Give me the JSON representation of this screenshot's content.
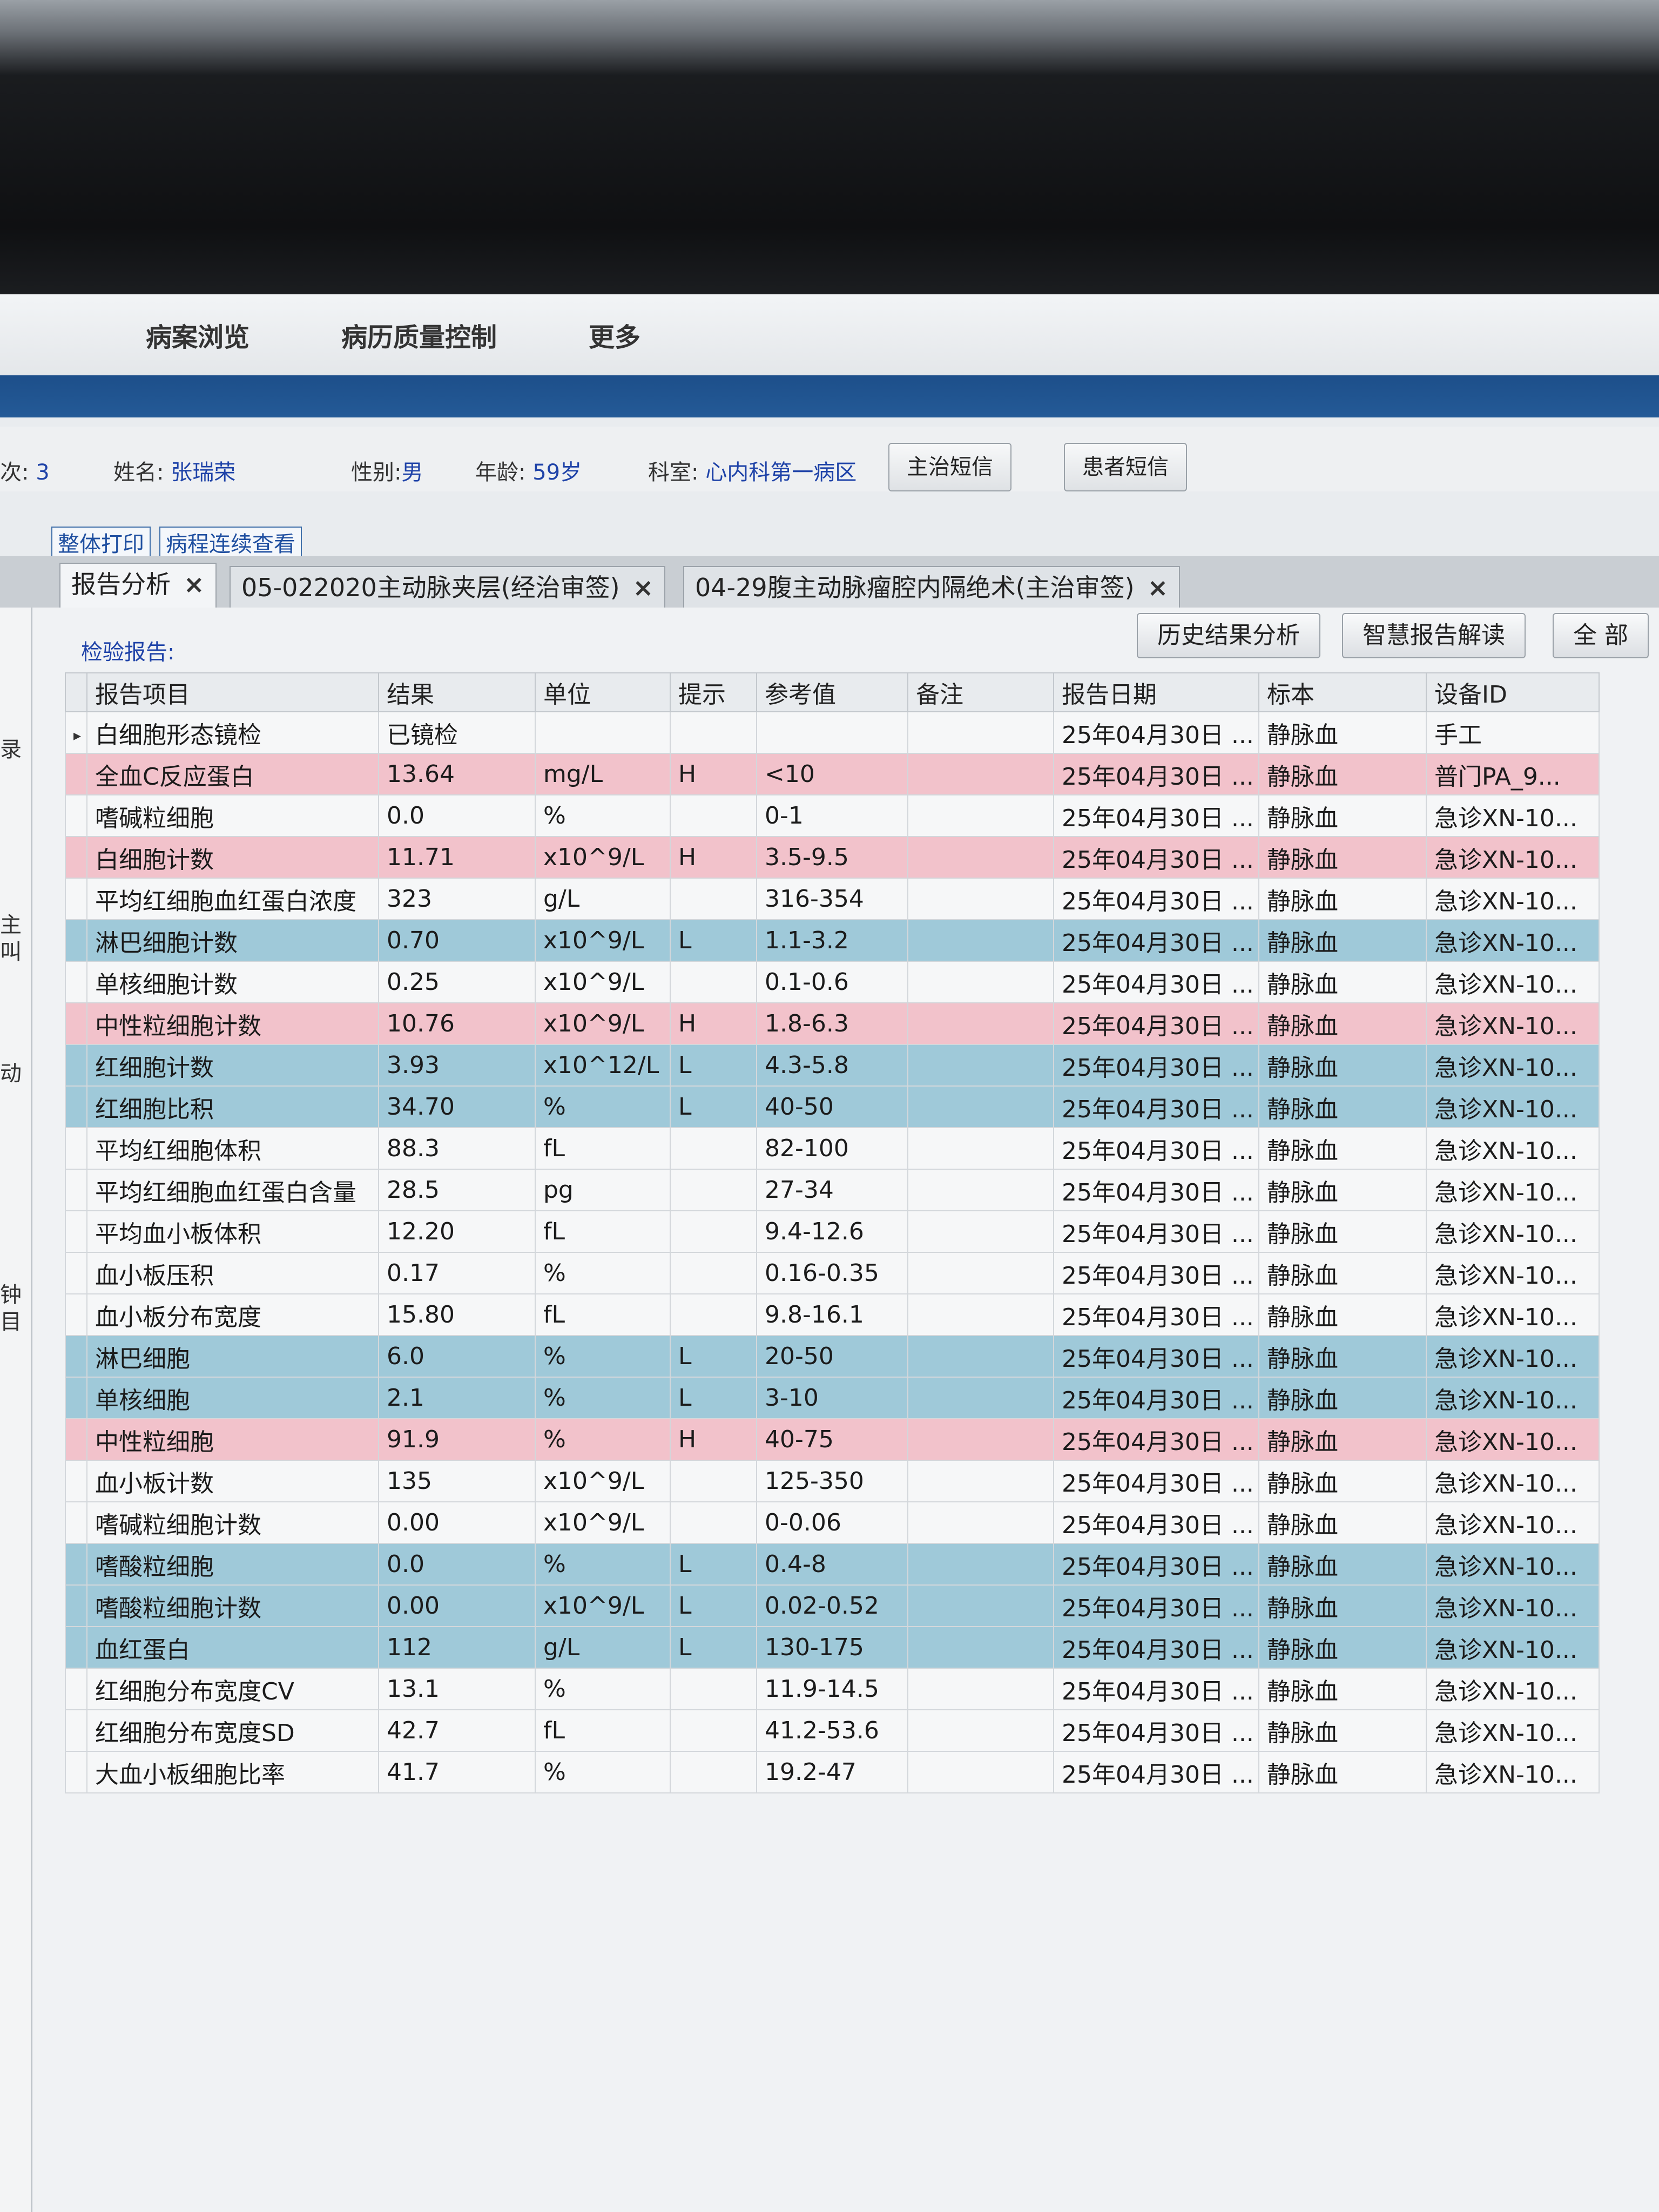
{
  "menu": [
    "病案浏览",
    "病历质量控制",
    "更多"
  ],
  "patient": {
    "visit_label": "次:",
    "visit_value": "3",
    "name_label": "姓名:",
    "name_value": "张瑞荣",
    "sex_label": "性别:",
    "sex_value": "男",
    "age_label": "年龄:",
    "age_value": "59岁",
    "dept_label": "科室:",
    "dept_value": "心内科第一病区",
    "sms_doctor": "主治短信",
    "sms_patient": "患者短信"
  },
  "links": {
    "print_all": "整体打印",
    "course_view": "病程连续查看"
  },
  "tabs": [
    {
      "label": "报告分析",
      "close": "×"
    },
    {
      "label": "05-022020主动脉夹层(经治审签)",
      "close": "×"
    },
    {
      "label": "04-29腹主动脉瘤腔内隔绝术(主治审签)",
      "close": "×"
    }
  ],
  "actions": {
    "history": "历史结果分析",
    "smart": "智慧报告解读",
    "all": "全 部"
  },
  "section_label": "检验报告:",
  "left_strip_chars": [
    "录",
    "主",
    "叫",
    "动",
    "钟",
    "目"
  ],
  "columns": [
    "报告项目",
    "结果",
    "单位",
    "提示",
    "参考值",
    "备注",
    "报告日期",
    "标本",
    "设备ID"
  ],
  "rows": [
    {
      "flag": "",
      "item": "白细胞形态镜检",
      "result": "已镜检",
      "unit": "",
      "hint": "",
      "ref": "",
      "note": "",
      "date": "25年04月30日 ...",
      "specimen": "静脉血",
      "device": "手工",
      "arrow": "▸"
    },
    {
      "flag": "high",
      "item": "全血C反应蛋白",
      "result": "13.64",
      "unit": "mg/L",
      "hint": "H",
      "ref": "<10",
      "note": "",
      "date": "25年04月30日 ...",
      "specimen": "静脉血",
      "device": "普门PA_9...",
      "arrow": ""
    },
    {
      "flag": "",
      "item": "嗜碱粒细胞",
      "result": "0.0",
      "unit": "%",
      "hint": "",
      "ref": "0-1",
      "note": "",
      "date": "25年04月30日 ...",
      "specimen": "静脉血",
      "device": "急诊XN-10...",
      "arrow": ""
    },
    {
      "flag": "high",
      "item": "白细胞计数",
      "result": "11.71",
      "unit": "x10^9/L",
      "hint": "H",
      "ref": "3.5-9.5",
      "note": "",
      "date": "25年04月30日 ...",
      "specimen": "静脉血",
      "device": "急诊XN-10...",
      "arrow": ""
    },
    {
      "flag": "",
      "item": "平均红细胞血红蛋白浓度",
      "result": "323",
      "unit": "g/L",
      "hint": "",
      "ref": "316-354",
      "note": "",
      "date": "25年04月30日 ...",
      "specimen": "静脉血",
      "device": "急诊XN-10...",
      "arrow": ""
    },
    {
      "flag": "low",
      "item": "淋巴细胞计数",
      "result": "0.70",
      "unit": "x10^9/L",
      "hint": "L",
      "ref": "1.1-3.2",
      "note": "",
      "date": "25年04月30日 ...",
      "specimen": "静脉血",
      "device": "急诊XN-10...",
      "arrow": ""
    },
    {
      "flag": "",
      "item": "单核细胞计数",
      "result": "0.25",
      "unit": "x10^9/L",
      "hint": "",
      "ref": "0.1-0.6",
      "note": "",
      "date": "25年04月30日 ...",
      "specimen": "静脉血",
      "device": "急诊XN-10...",
      "arrow": ""
    },
    {
      "flag": "high",
      "item": "中性粒细胞计数",
      "result": "10.76",
      "unit": "x10^9/L",
      "hint": "H",
      "ref": "1.8-6.3",
      "note": "",
      "date": "25年04月30日 ...",
      "specimen": "静脉血",
      "device": "急诊XN-10...",
      "arrow": ""
    },
    {
      "flag": "low",
      "item": "红细胞计数",
      "result": "3.93",
      "unit": "x10^12/L",
      "hint": "L",
      "ref": "4.3-5.8",
      "note": "",
      "date": "25年04月30日 ...",
      "specimen": "静脉血",
      "device": "急诊XN-10...",
      "arrow": ""
    },
    {
      "flag": "low",
      "item": "红细胞比积",
      "result": "34.70",
      "unit": "%",
      "hint": "L",
      "ref": "40-50",
      "note": "",
      "date": "25年04月30日 ...",
      "specimen": "静脉血",
      "device": "急诊XN-10...",
      "arrow": ""
    },
    {
      "flag": "",
      "item": "平均红细胞体积",
      "result": "88.3",
      "unit": "fL",
      "hint": "",
      "ref": "82-100",
      "note": "",
      "date": "25年04月30日 ...",
      "specimen": "静脉血",
      "device": "急诊XN-10...",
      "arrow": ""
    },
    {
      "flag": "",
      "item": "平均红细胞血红蛋白含量",
      "result": "28.5",
      "unit": "pg",
      "hint": "",
      "ref": "27-34",
      "note": "",
      "date": "25年04月30日 ...",
      "specimen": "静脉血",
      "device": "急诊XN-10...",
      "arrow": ""
    },
    {
      "flag": "",
      "item": "平均血小板体积",
      "result": "12.20",
      "unit": "fL",
      "hint": "",
      "ref": "9.4-12.6",
      "note": "",
      "date": "25年04月30日 ...",
      "specimen": "静脉血",
      "device": "急诊XN-10...",
      "arrow": ""
    },
    {
      "flag": "",
      "item": "血小板压积",
      "result": "0.17",
      "unit": "%",
      "hint": "",
      "ref": "0.16-0.35",
      "note": "",
      "date": "25年04月30日 ...",
      "specimen": "静脉血",
      "device": "急诊XN-10...",
      "arrow": ""
    },
    {
      "flag": "",
      "item": "血小板分布宽度",
      "result": "15.80",
      "unit": "fL",
      "hint": "",
      "ref": "9.8-16.1",
      "note": "",
      "date": "25年04月30日 ...",
      "specimen": "静脉血",
      "device": "急诊XN-10...",
      "arrow": ""
    },
    {
      "flag": "low",
      "item": "淋巴细胞",
      "result": "6.0",
      "unit": "%",
      "hint": "L",
      "ref": "20-50",
      "note": "",
      "date": "25年04月30日 ...",
      "specimen": "静脉血",
      "device": "急诊XN-10...",
      "arrow": ""
    },
    {
      "flag": "low",
      "item": "单核细胞",
      "result": "2.1",
      "unit": "%",
      "hint": "L",
      "ref": "3-10",
      "note": "",
      "date": "25年04月30日 ...",
      "specimen": "静脉血",
      "device": "急诊XN-10...",
      "arrow": ""
    },
    {
      "flag": "high",
      "item": "中性粒细胞",
      "result": "91.9",
      "unit": "%",
      "hint": "H",
      "ref": "40-75",
      "note": "",
      "date": "25年04月30日 ...",
      "specimen": "静脉血",
      "device": "急诊XN-10...",
      "arrow": ""
    },
    {
      "flag": "",
      "item": "血小板计数",
      "result": "135",
      "unit": "x10^9/L",
      "hint": "",
      "ref": "125-350",
      "note": "",
      "date": "25年04月30日 ...",
      "specimen": "静脉血",
      "device": "急诊XN-10...",
      "arrow": ""
    },
    {
      "flag": "",
      "item": "嗜碱粒细胞计数",
      "result": "0.00",
      "unit": "x10^9/L",
      "hint": "",
      "ref": "0-0.06",
      "note": "",
      "date": "25年04月30日 ...",
      "specimen": "静脉血",
      "device": "急诊XN-10...",
      "arrow": ""
    },
    {
      "flag": "low",
      "item": "嗜酸粒细胞",
      "result": "0.0",
      "unit": "%",
      "hint": "L",
      "ref": "0.4-8",
      "note": "",
      "date": "25年04月30日 ...",
      "specimen": "静脉血",
      "device": "急诊XN-10...",
      "arrow": ""
    },
    {
      "flag": "low",
      "item": "嗜酸粒细胞计数",
      "result": "0.00",
      "unit": "x10^9/L",
      "hint": "L",
      "ref": "0.02-0.52",
      "note": "",
      "date": "25年04月30日 ...",
      "specimen": "静脉血",
      "device": "急诊XN-10...",
      "arrow": ""
    },
    {
      "flag": "low",
      "item": "血红蛋白",
      "result": "112",
      "unit": "g/L",
      "hint": "L",
      "ref": "130-175",
      "note": "",
      "date": "25年04月30日 ...",
      "specimen": "静脉血",
      "device": "急诊XN-10...",
      "arrow": ""
    },
    {
      "flag": "",
      "item": "红细胞分布宽度CV",
      "result": "13.1",
      "unit": "%",
      "hint": "",
      "ref": "11.9-14.5",
      "note": "",
      "date": "25年04月30日 ...",
      "specimen": "静脉血",
      "device": "急诊XN-10...",
      "arrow": ""
    },
    {
      "flag": "",
      "item": "红细胞分布宽度SD",
      "result": "42.7",
      "unit": "fL",
      "hint": "",
      "ref": "41.2-53.6",
      "note": "",
      "date": "25年04月30日 ...",
      "specimen": "静脉血",
      "device": "急诊XN-10...",
      "arrow": ""
    },
    {
      "flag": "",
      "item": "大血小板细胞比率",
      "result": "41.7",
      "unit": "%",
      "hint": "",
      "ref": "19.2-47",
      "note": "",
      "date": "25年04月30日 ...",
      "specimen": "静脉血",
      "device": "急诊XN-10...",
      "arrow": ""
    }
  ],
  "colors": {
    "high_row": "#f2c2cb",
    "low_row": "#9fc9d9",
    "accent_blue": "#1f43a8",
    "header_bar": "#1d4f8a"
  }
}
